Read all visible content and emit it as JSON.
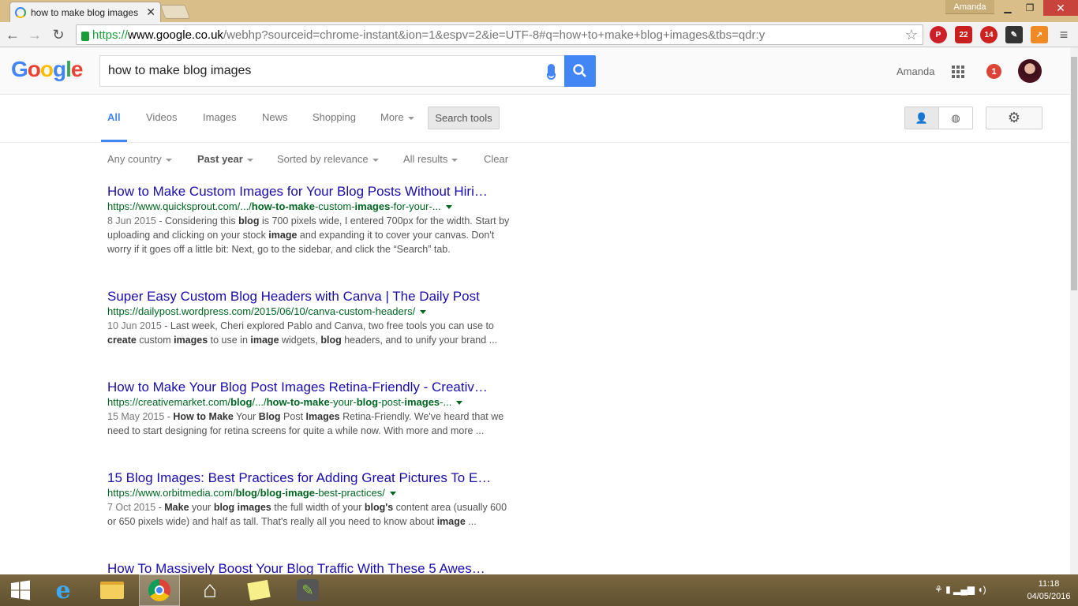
{
  "browser": {
    "tab_title": "how to make blog images",
    "user": "Amanda",
    "url_https": "https://",
    "url_domain": "www.google.co.uk",
    "url_rest": "/webhp?sourceid=chrome-instant&ion=1&espv=2&ie=UTF-8#q=how+to+make+blog+images&tbs=qdr:y",
    "ext_abp_count": "22",
    "ext_badge_count": "14"
  },
  "google": {
    "logo": "Google",
    "query": "how to make blog images",
    "account_name": "Amanda",
    "notification_count": "1"
  },
  "tabs": [
    {
      "label": "All"
    },
    {
      "label": "Videos"
    },
    {
      "label": "Images"
    },
    {
      "label": "News"
    },
    {
      "label": "Shopping"
    },
    {
      "label": "More"
    }
  ],
  "search_tools": "Search tools",
  "filters": {
    "country": "Any country",
    "time": "Past year",
    "sort": "Sorted by relevance",
    "results": "All results",
    "clear": "Clear"
  },
  "results": [
    {
      "title": "How to Make Custom Images for Your Blog Posts Without Hiri…",
      "url_a": "https://www.quicksprout.com/.../",
      "url_b": "how-to-make",
      "url_c": "-custom-",
      "url_d": "images",
      "url_e": "-for-your-...",
      "date": "8 Jun 2015",
      "s1": " - Considering this ",
      "s1b": "blog",
      "s2": " is 700 pixels wide, I entered 700px for the width. Start by uploading and clicking on your stock ",
      "s2b": "image",
      "s3": " and expanding it to cover your canvas. Don't worry if it goes off a little bit: Next, go to the sidebar, and click the “Search” tab."
    },
    {
      "title": "Super Easy Custom Blog Headers with Canva | The Daily Post",
      "url": "https://dailypost.wordpress.com/2015/06/10/canva-custom-headers/",
      "date": "10 Jun 2015",
      "s1": " - Last week, Cheri explored Pablo and Canva, two free tools you can use to ",
      "s1b": "create",
      "s2": " custom ",
      "s2b": "images",
      "s3": " to use in ",
      "s3b": "image",
      "s4": " widgets, ",
      "s4b": "blog",
      "s5": " headers, and to unify your brand ..."
    },
    {
      "title": "How to Make Your Blog Post Images Retina-Friendly - Creativ…",
      "url_a": "https://creativemarket.com/",
      "url_b": "blog",
      "url_c": "/.../",
      "url_d": "how-to-make",
      "url_e": "-your-",
      "url_f": "blog",
      "url_g": "-post-",
      "url_h": "images",
      "url_i": "-...",
      "date": "15 May 2015",
      "s0": " - ",
      "s1b": "How",
      "s1": " ",
      "s2b": "to Make",
      "s2": " Your ",
      "s3b": "Blog",
      "s3": " Post ",
      "s4b": "Images",
      "s4": " Retina-Friendly. We've heard that we need to start designing for retina screens for quite a while now. With more and more ..."
    },
    {
      "title": "15 Blog Images: Best Practices for Adding Great Pictures To E…",
      "url_a": "https://www.orbitmedia.com/",
      "url_b": "blog",
      "url_c": "/",
      "url_d": "blog",
      "url_e": "-",
      "url_f": "image",
      "url_g": "-best-practices/",
      "date": "7 Oct 2015",
      "s0": " - ",
      "s1b": "Make",
      "s1": " your ",
      "s2b": "blog images",
      "s2": " the full width of your ",
      "s3b": "blog's",
      "s3": " content area (usually 600 or 650 pixels wide) and half as tall. That's really all you need to know about ",
      "s4b": "image",
      "s4": " ..."
    },
    {
      "title": "How To Massively Boost Your Blog Traffic With These 5 Awes…"
    }
  ],
  "taskbar": {
    "time": "11:18",
    "date": "04/05/2016"
  },
  "colors": {
    "accent": "#4285f4",
    "link": "#1a0dab",
    "url": "#006621"
  }
}
